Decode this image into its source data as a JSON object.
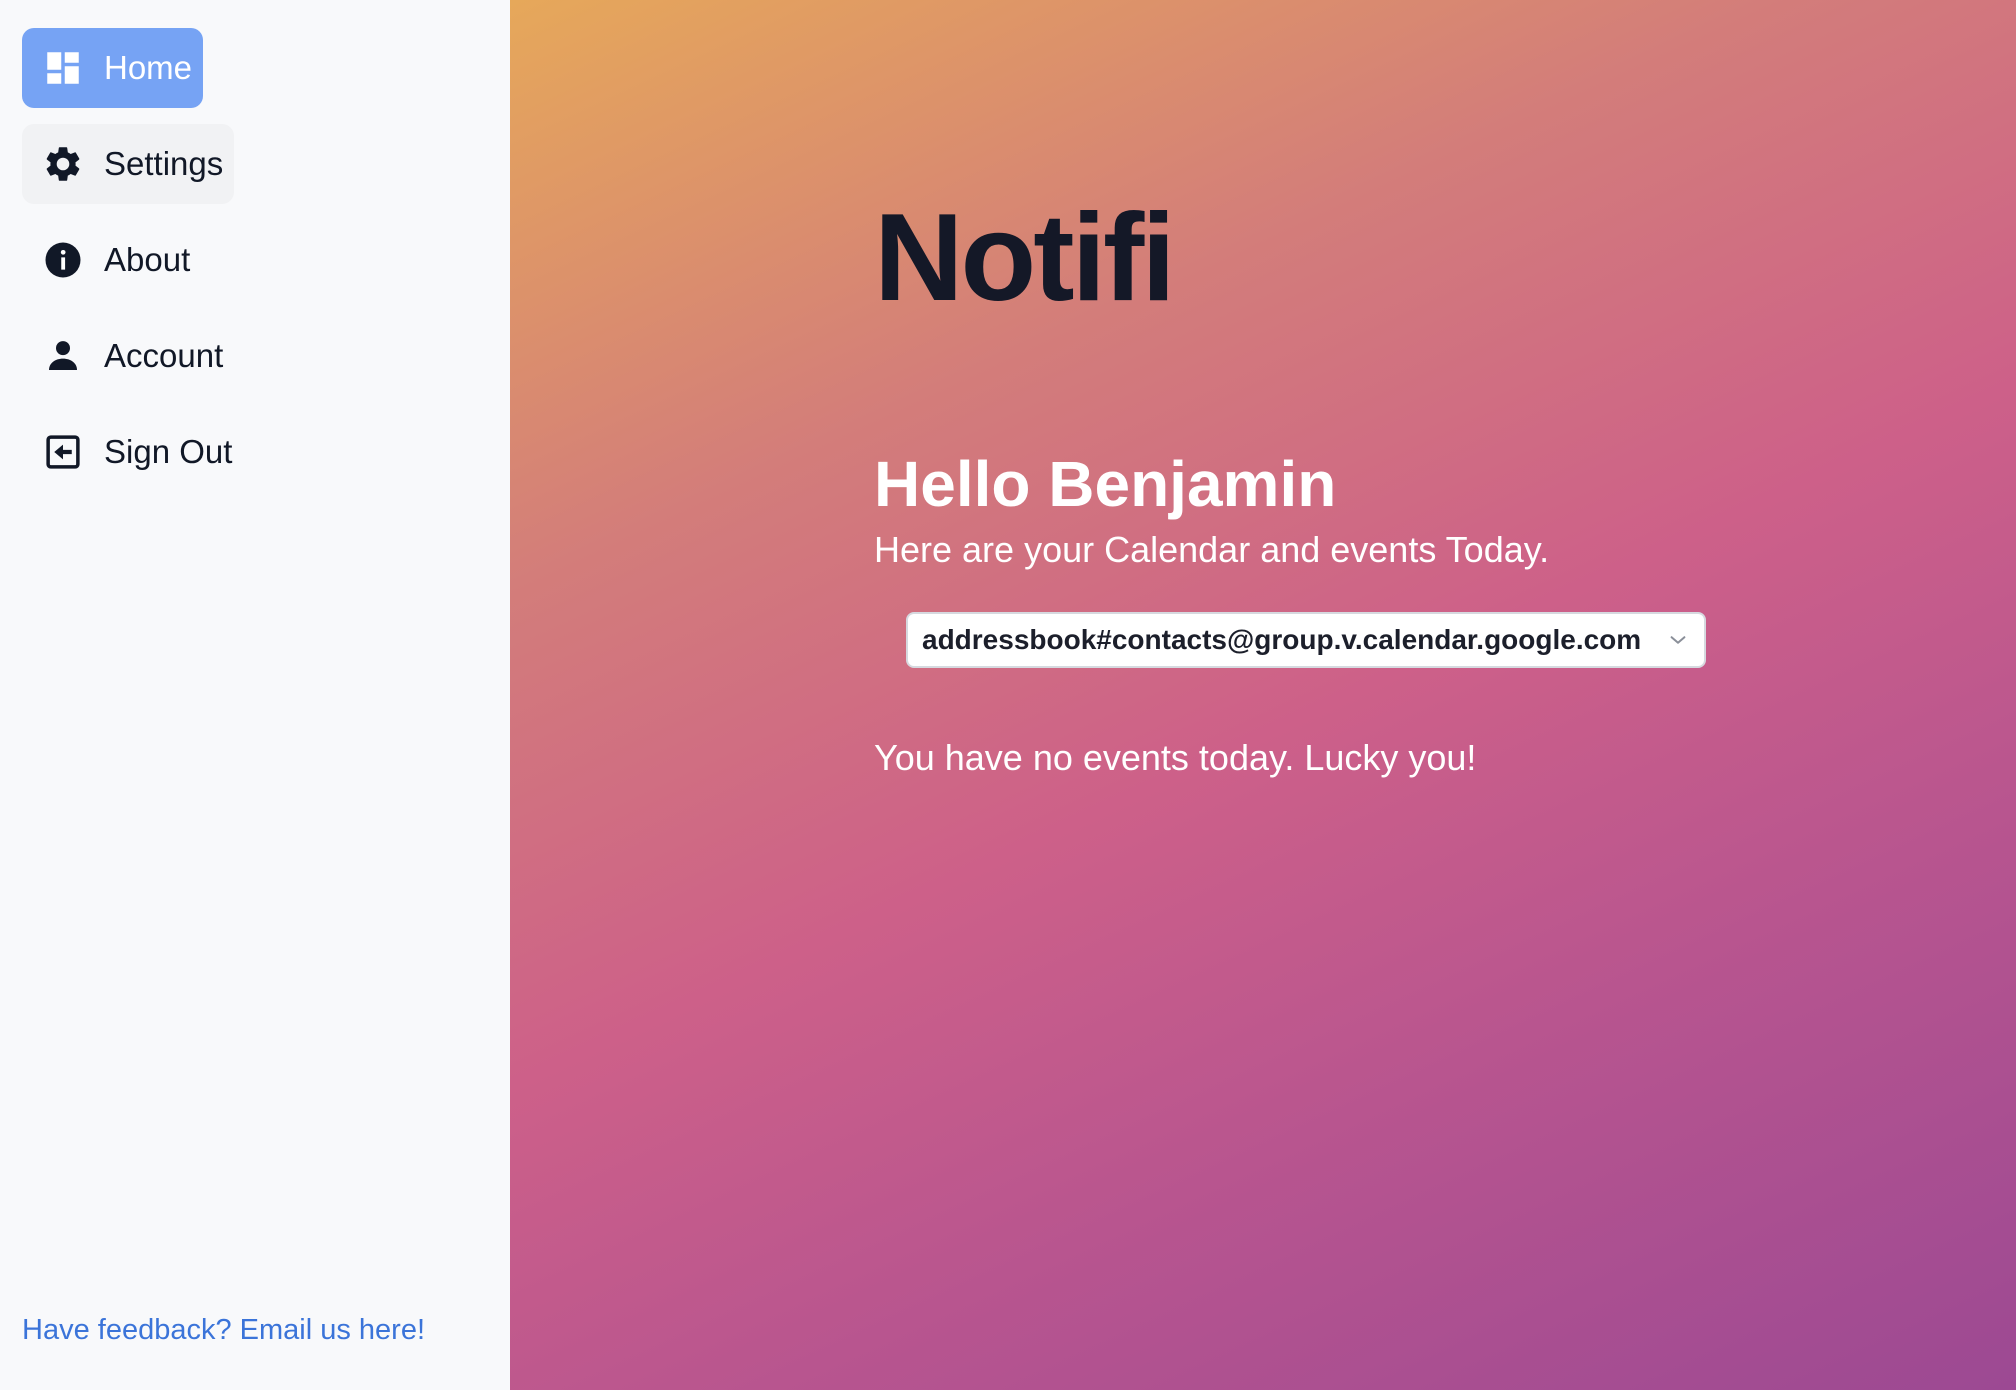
{
  "sidebar": {
    "items": [
      {
        "label": "Home",
        "icon": "dashboard-icon",
        "active": true
      },
      {
        "label": "Settings",
        "icon": "gear-icon",
        "hovered": true
      },
      {
        "label": "About",
        "icon": "info-icon"
      },
      {
        "label": "Account",
        "icon": "user-icon"
      },
      {
        "label": "Sign Out",
        "icon": "sign-out-icon"
      }
    ],
    "feedback_link": "Have feedback? Email us here!"
  },
  "main": {
    "app_title": "Notifi",
    "greeting": "Hello Benjamin",
    "subtitle": "Here are your Calendar and events Today.",
    "calendar_select": {
      "selected": "addressbook#contacts@group.v.calendar.google.com"
    },
    "empty_message": "You have no events today. Lucky you!"
  },
  "colors": {
    "active_nav_bg": "#76a3f4",
    "link": "#3b74d9",
    "title_text": "#141827",
    "gradient_top": "#e6a85a",
    "gradient_mid": "#cd6089",
    "gradient_bottom": "#9c4993"
  }
}
